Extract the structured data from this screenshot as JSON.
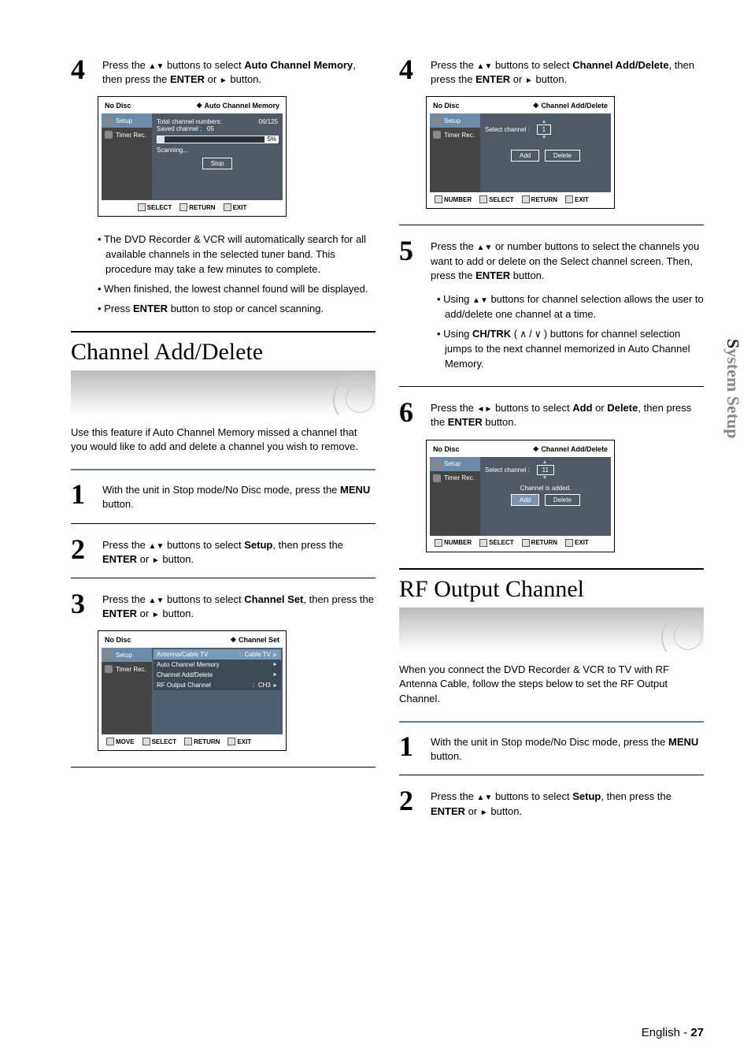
{
  "pageFooter": {
    "lang": "English",
    "page": "27"
  },
  "sideTab": {
    "full": "System Setup",
    "hi": "S",
    "rest": "ystem Setup"
  },
  "left": {
    "step4": {
      "pre": "Press the ",
      "mid": " buttons to select ",
      "target": "Auto Channel Memory",
      "post1": ", then press the ",
      "enter": "ENTER",
      "post2": " or ",
      "post3": " button."
    },
    "scrA": {
      "title": "No Disc",
      "crumb": "Auto Channel Memory",
      "side1": "Setup",
      "side2": "Timer Rec.",
      "l1": "Total channel numbers:",
      "v1": "06/125",
      "l2": "Saved channel :",
      "v2": "05",
      "pct": "5%",
      "scan": "Scanning...",
      "stop": "Stop",
      "fSel": "SELECT",
      "fRet": "RETURN",
      "fEx": "EXIT"
    },
    "bulletsA": {
      "b1": "The DVD Recorder & VCR will automatically search for all available channels in the selected tuner band. This procedure may take a few minutes to complete.",
      "b2": "When finished, the lowest channel found will be displayed.",
      "b3pre": "Press ",
      "b3enter": "ENTER",
      "b3post": " button to stop or cancel scanning."
    },
    "secTitle": "Channel Add/Delete",
    "intro": "Use this feature if Auto Channel Memory missed a channel that you would like to add and delete a channel you wish to remove.",
    "step1": {
      "t1": "With the unit in Stop mode/No Disc mode, press the ",
      "menu": "MENU",
      "t2": " button."
    },
    "step2": {
      "t1": "Press the ",
      "t2": " buttons to select ",
      "setup": "Setup",
      "t3": ", then press the ",
      "enter": "ENTER",
      "t4": " or ",
      "t5": " button."
    },
    "step3": {
      "t1": "Press the ",
      "t2": " buttons to select ",
      "target": "Channel Set",
      "t3": ", then press the ",
      "enter": "ENTER",
      "t4": " or ",
      "t5": " button."
    },
    "scrB": {
      "title": "No Disc",
      "crumb": "Channel Set",
      "side1": "Setup",
      "side2": "Timer Rec.",
      "r1": "Antenna/Cable TV",
      "r1v": "Cable TV",
      "r2": "Auto Channel Memory",
      "r3": "Channel Add/Delete",
      "r4": "RF Output Channel",
      "r4v": "CH3",
      "fMove": "MOVE",
      "fSel": "SELECT",
      "fRet": "RETURN",
      "fEx": "EXIT"
    }
  },
  "right": {
    "step4": {
      "pre": "Press the ",
      "mid": " buttons to select ",
      "target": "Channel Add/Delete",
      "post1": ", then press the ",
      "enter": "ENTER",
      "post2": " or ",
      "post3": " button."
    },
    "scrC": {
      "title": "No Disc",
      "crumb": "Channel Add/Delete",
      "side1": "Setup",
      "side2": "Timer Rec.",
      "sel": "Select channel :",
      "val": "1",
      "add": "Add",
      "del": "Delete",
      "fNum": "NUMBER",
      "fSel": "SELECT",
      "fRet": "RETURN",
      "fEx": "EXIT"
    },
    "step5": {
      "t1": "Press the ",
      "t2": " or number buttons to select the channels you want to add or delete on the Select channel screen. Then, press the ",
      "enter": "ENTER",
      "t3": " button."
    },
    "bulletsB": {
      "b1pre": "Using  ",
      "b1post": " buttons for channel selection allows the user to add/delete one channel at a time.",
      "b2pre": "Using ",
      "b2ch": "CH/TRK",
      "b2mid": " ( ",
      " b2sym": " / ",
      "b2post": " ) buttons for channel selection jumps to the next channel memorized in Auto Channel Memory."
    },
    "step6": {
      "t1": "Press the ",
      "t2": " buttons to select ",
      "add": "Add",
      "or": " or ",
      "del": "Delete",
      "t3": ", then press the ",
      "enter": "ENTER",
      "t4": " button."
    },
    "scrD": {
      "title": "No Disc",
      "crumb": "Channel Add/Delete",
      "side1": "Setup",
      "side2": "Timer Rec.",
      "sel": "Select channel :",
      "val": "11",
      "status": "Channel is added.",
      "add": "Add",
      "del": "Delete",
      "fNum": "NUMBER",
      "fSel": "SELECT",
      "fRet": "RETURN",
      "fEx": "EXIT"
    },
    "secTitle": "RF Output Channel",
    "intro": "When you connect the DVD Recorder & VCR to TV with RF Antenna Cable, follow the steps below to set the RF Output Channel.",
    "step1": {
      "t1": "With the unit in Stop mode/No Disc mode, press the ",
      "menu": "MENU",
      "t2": " button."
    },
    "step2": {
      "t1": "Press the ",
      "t2": " buttons to select ",
      "setup": "Setup",
      "t3": ", then press the ",
      "enter": "ENTER",
      "t4": " or ",
      "t5": " button."
    }
  }
}
